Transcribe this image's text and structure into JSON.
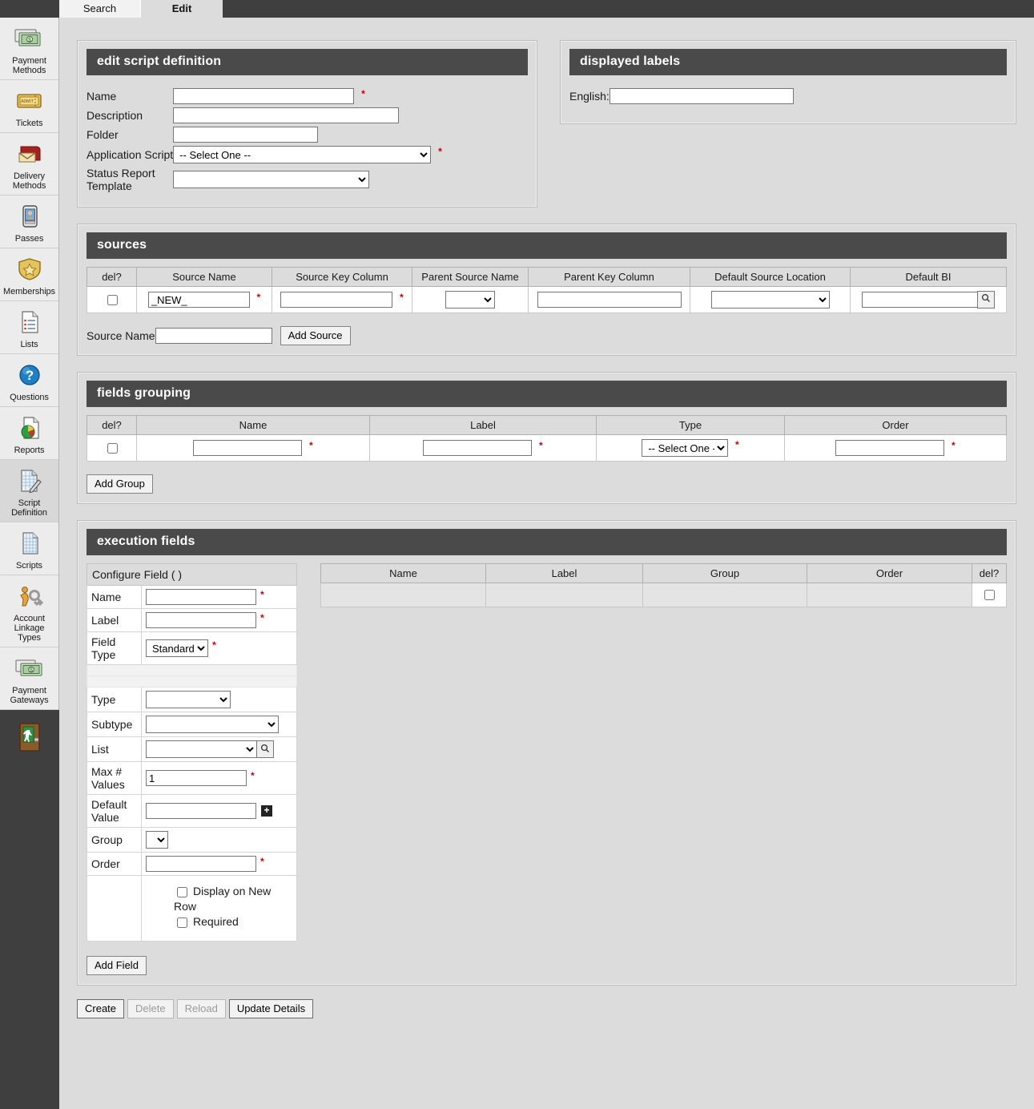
{
  "tabs": [
    {
      "label": "Search",
      "active": false
    },
    {
      "label": "Edit",
      "active": true
    }
  ],
  "sidebar": {
    "items": [
      {
        "label": "Payment\nMethods",
        "icon": "payment-methods-icon",
        "selected": false
      },
      {
        "label": "Tickets",
        "icon": "tickets-icon",
        "selected": false
      },
      {
        "label": "Delivery\nMethods",
        "icon": "delivery-methods-icon",
        "selected": false
      },
      {
        "label": "Passes",
        "icon": "passes-icon",
        "selected": false
      },
      {
        "label": "Memberships",
        "icon": "memberships-icon",
        "selected": false
      },
      {
        "label": "Lists",
        "icon": "lists-icon",
        "selected": false
      },
      {
        "label": "Questions",
        "icon": "questions-icon",
        "selected": false
      },
      {
        "label": "Reports",
        "icon": "reports-icon",
        "selected": false
      },
      {
        "label": "Script Definition",
        "icon": "script-definition-icon",
        "selected": true
      },
      {
        "label": "Scripts",
        "icon": "scripts-icon",
        "selected": false
      },
      {
        "label": "Account\nLinkage Types",
        "icon": "account-linkage-types-icon",
        "selected": false
      },
      {
        "label": "Payment\nGateways",
        "icon": "payment-gateways-icon",
        "selected": false
      }
    ],
    "exit": {
      "icon": "exit-door-icon",
      "label": ""
    }
  },
  "edit_script_definition": {
    "title": "edit script definition",
    "fields": {
      "name": {
        "label": "Name",
        "value": "",
        "required": true
      },
      "description": {
        "label": "Description",
        "value": "",
        "required": false
      },
      "folder": {
        "label": "Folder",
        "value": "",
        "required": false
      },
      "application_script": {
        "label": "Application Script",
        "value": "-- Select One --",
        "required": true
      },
      "status_report_template": {
        "label": "Status Report\nTemplate",
        "value": "",
        "required": false
      }
    }
  },
  "displayed_labels": {
    "title": "displayed labels",
    "english": {
      "label": "English:",
      "value": ""
    }
  },
  "sources": {
    "title": "sources",
    "columns": [
      "del?",
      "Source Name",
      "Source Key Column",
      "Parent Source Name",
      "Parent Key Column",
      "Default Source Location",
      "Default BI"
    ],
    "rows": [
      {
        "del": false,
        "source_name": "_NEW_",
        "source_key_column": "",
        "parent_source_name": "",
        "parent_key_column": "",
        "default_source_location": "",
        "default_bi": ""
      }
    ],
    "add_label": "Source Name",
    "add_value": "",
    "add_button": "Add Source"
  },
  "fields_grouping": {
    "title": "fields grouping",
    "columns": [
      "del?",
      "Name",
      "Label",
      "Type",
      "Order"
    ],
    "rows": [
      {
        "del": false,
        "name": "",
        "label": "",
        "type": "-- Select One --",
        "order": ""
      }
    ],
    "add_button": "Add Group"
  },
  "execution_fields": {
    "title": "execution fields",
    "configure": {
      "heading": "Configure Field ( )",
      "rows": [
        {
          "label": "Name",
          "kind": "text",
          "value": "",
          "required": true
        },
        {
          "label": "Label",
          "kind": "text",
          "value": "",
          "required": true
        },
        {
          "label": "Field\nType",
          "kind": "select-small",
          "value": "Standard",
          "required": true
        },
        {
          "label": "",
          "kind": "spacer",
          "value": ""
        },
        {
          "label": "",
          "kind": "spacer",
          "value": ""
        },
        {
          "label": "Type",
          "kind": "select",
          "value": "",
          "required": false
        },
        {
          "label": "Subtype",
          "kind": "select-wide",
          "value": "",
          "required": false
        },
        {
          "label": "List",
          "kind": "select-search",
          "value": "",
          "required": false
        },
        {
          "label": "Max #\nValues",
          "kind": "text",
          "value": "1",
          "required": true
        },
        {
          "label": "Default\nValue",
          "kind": "text-plus",
          "value": "",
          "required": false
        },
        {
          "label": "Group",
          "kind": "select-tiny",
          "value": "",
          "required": false
        },
        {
          "label": "Order",
          "kind": "text",
          "value": "",
          "required": true
        }
      ],
      "checkboxes": [
        {
          "label": "Display on New Row",
          "checked": false
        },
        {
          "label": "Required",
          "checked": false
        }
      ]
    },
    "table": {
      "columns": [
        "Name",
        "Label",
        "Group",
        "Order",
        "del?"
      ],
      "rows": [
        {
          "name": "",
          "label": "",
          "group": "",
          "order": "",
          "del": false
        }
      ]
    },
    "add_button": "Add Field"
  },
  "footer": {
    "buttons": [
      {
        "label": "Create",
        "disabled": false
      },
      {
        "label": "Delete",
        "disabled": true
      },
      {
        "label": "Reload",
        "disabled": true
      },
      {
        "label": "Update Details",
        "disabled": false
      }
    ]
  },
  "icons": {
    "search": "search-icon",
    "plus": "plus-icon"
  }
}
